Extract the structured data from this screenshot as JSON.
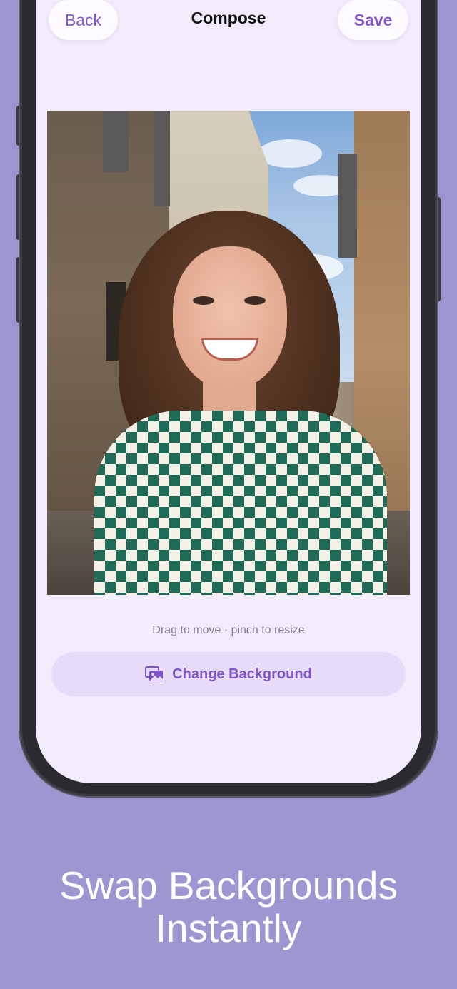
{
  "header": {
    "back_label": "Back",
    "title": "Compose",
    "save_label": "Save"
  },
  "editor": {
    "hint": "Drag to move · pinch to resize",
    "change_background_label": "Change Background",
    "change_background_icon": "photos-stack-icon"
  },
  "headline": {
    "line1": "Swap Backgrounds",
    "line2": "Instantly"
  },
  "colors": {
    "page_background": "#9d97d1",
    "screen_background": "#f1ebfb",
    "accent": "#7f55c8",
    "button_tint": "#e6dcf7"
  }
}
